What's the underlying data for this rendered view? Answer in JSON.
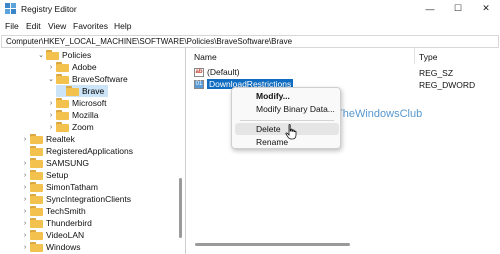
{
  "window": {
    "title": "Registry Editor",
    "controls": {
      "minimize": "—",
      "maximize": "☐",
      "close": "✕"
    }
  },
  "menu": [
    "File",
    "Edit",
    "View",
    "Favorites",
    "Help"
  ],
  "address": "Computer\\HKEY_LOCAL_MACHINE\\SOFTWARE\\Policies\\BraveSoftware\\Brave",
  "tree": [
    {
      "label": "Policies",
      "arrow": "⌄"
    },
    {
      "label": "Adobe",
      "arrow": "›"
    },
    {
      "label": "BraveSoftware",
      "arrow": "⌄"
    },
    {
      "label": "Brave",
      "arrow": "",
      "selected": true
    },
    {
      "label": "Microsoft",
      "arrow": "›"
    },
    {
      "label": "Mozilla",
      "arrow": "›"
    },
    {
      "label": "Zoom",
      "arrow": "›"
    },
    {
      "label": "Realtek",
      "arrow": "›"
    },
    {
      "label": "RegisteredApplications",
      "arrow": ""
    },
    {
      "label": "SAMSUNG",
      "arrow": "›"
    },
    {
      "label": "Setup",
      "arrow": "›"
    },
    {
      "label": "SimonTatham",
      "arrow": "›"
    },
    {
      "label": "SyncIntegrationClients",
      "arrow": "›"
    },
    {
      "label": "TechSmith",
      "arrow": "›"
    },
    {
      "label": "Thunderbird",
      "arrow": "›"
    },
    {
      "label": "VideoLAN",
      "arrow": "›"
    },
    {
      "label": "Windows",
      "arrow": "›"
    }
  ],
  "list": {
    "columns": [
      "Name",
      "Type"
    ],
    "rows": [
      {
        "name": "(Default)",
        "type": "REG_SZ",
        "icon": "ab",
        "kind": "sz"
      },
      {
        "name": "DownloadRestrictions",
        "type": "REG_DWORD",
        "icon": "01",
        "kind": "dword",
        "selected": true
      }
    ]
  },
  "context_menu": {
    "items": [
      "Modify...",
      "Modify Binary Data...",
      "Delete",
      "Rename"
    ]
  },
  "watermark": "TheWindowsClub"
}
